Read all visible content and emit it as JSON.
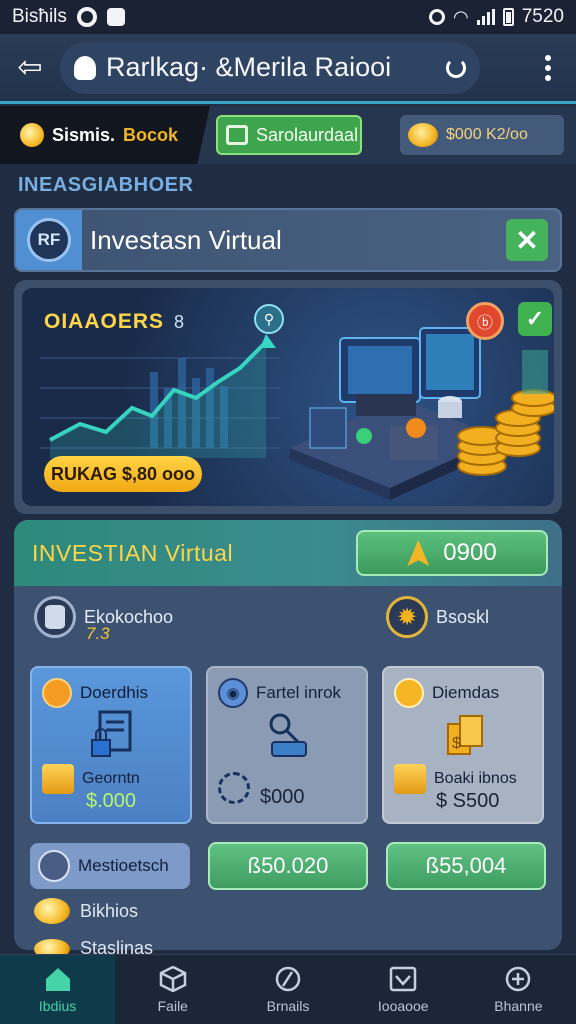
{
  "status_bar": {
    "carrier": "Bisħils",
    "time": "7520"
  },
  "app_bar": {
    "title": "Rarlkag· &Merila Raiooi"
  },
  "tabs": {
    "first_a": "Sismis.",
    "first_b": "Bocok",
    "second": "Sarolaurdaal",
    "third": "$000 K2/oo"
  },
  "section_heading": "INEASGIABHOER",
  "invest_bar": {
    "badge": "RF",
    "title": "Investasn Virtual"
  },
  "hero": {
    "title": "OIAAOERS",
    "title_suffix": "8",
    "pill": "RUKAG $,80 ooo"
  },
  "invest_section": {
    "title": "INVESTIAN Virtual",
    "amount": "0900",
    "stat_left_label": "Ekokochoo",
    "stat_left_value": "7.3",
    "stat_right_label": "Bsoskl",
    "cards": [
      {
        "title": "Doerdhis",
        "foot_label": "Georntn",
        "value": "$.000"
      },
      {
        "title": "Fartel inrok",
        "value": "$000"
      },
      {
        "title": "Diemdas",
        "foot_label": "Boaki ibnos",
        "value": "$ S500"
      }
    ],
    "pill_label": "Mestioetsch",
    "button_a": "ß50.020",
    "button_b": "ß55,004",
    "row4_label": "Bikhios",
    "row5_label": "Staslinas"
  },
  "bottom_nav": [
    {
      "label": "Ibdius",
      "icon": "home-icon",
      "active": true
    },
    {
      "label": "Faile",
      "icon": "cube-icon",
      "active": false
    },
    {
      "label": "Brnails",
      "icon": "compass-icon",
      "active": false
    },
    {
      "label": "Iooaooe",
      "icon": "chart-icon",
      "active": false
    },
    {
      "label": "Bhanne",
      "icon": "plus-circle-icon",
      "active": false
    }
  ],
  "colors": {
    "accent_gold": "#ffd64a",
    "accent_green": "#3ea54e",
    "accent_teal": "#3aa3c7"
  }
}
